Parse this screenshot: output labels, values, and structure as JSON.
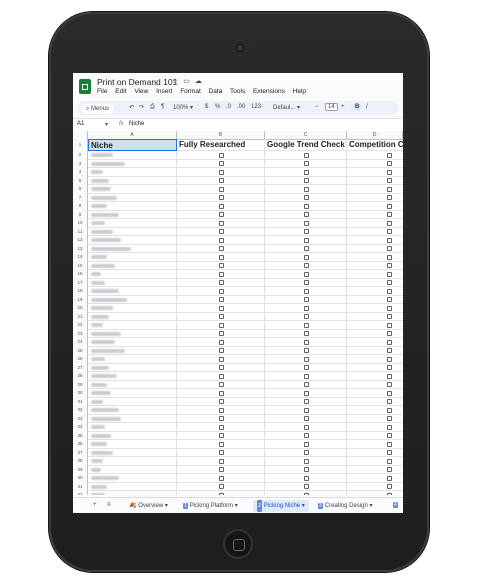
{
  "doc": {
    "title": "Print on Demand 101"
  },
  "menu": [
    "File",
    "Edit",
    "View",
    "Insert",
    "Format",
    "Data",
    "Tools",
    "Extensions",
    "Help"
  ],
  "toolbar": {
    "search_label": "Menus",
    "zoom": "100%",
    "currency": "$",
    "percent": "%",
    "dec_decrease": ".0",
    "dec_increase": ".00",
    "number_format": "123",
    "font": "Defaul...",
    "font_size": "14",
    "bold": "B",
    "italic": "I"
  },
  "formula_bar": {
    "cell_ref": "A1",
    "fx": "fx",
    "value": "Niche"
  },
  "columns": [
    "A",
    "B",
    "C",
    "D"
  ],
  "headers": [
    "Niche",
    "Fully Researched",
    "Google Trend Check",
    "Competition Check"
  ],
  "row_numbers": [
    "1",
    "2",
    "3",
    "4",
    "5",
    "6",
    "7",
    "8",
    "9",
    "10",
    "11",
    "12",
    "13",
    "14",
    "15",
    "16",
    "17",
    "18",
    "19",
    "20",
    "21",
    "22",
    "23",
    "24",
    "25",
    "26",
    "27",
    "28",
    "29",
    "30",
    "31",
    "32",
    "33",
    "34",
    "35",
    "36",
    "37",
    "38",
    "39",
    "40",
    "41",
    "42"
  ],
  "sheet_tabs": [
    {
      "num": "",
      "label": "Overview"
    },
    {
      "num": "1",
      "label": "Picking Platform"
    },
    {
      "num": "2",
      "label": "Picking Niche"
    },
    {
      "num": "3",
      "label": "Creating Design"
    },
    {
      "num": "4",
      "label": ""
    }
  ],
  "colors": {
    "sheets_green": "#188038",
    "active_tab": "#0b57d0",
    "selected_cell": "#cfe0ec"
  },
  "icons": [
    "star-icon",
    "move-folder-icon",
    "cloud-icon",
    "search-icon",
    "undo-icon",
    "redo-icon",
    "print-icon",
    "paint-format-icon",
    "add-sheet-icon",
    "all-sheets-icon"
  ]
}
